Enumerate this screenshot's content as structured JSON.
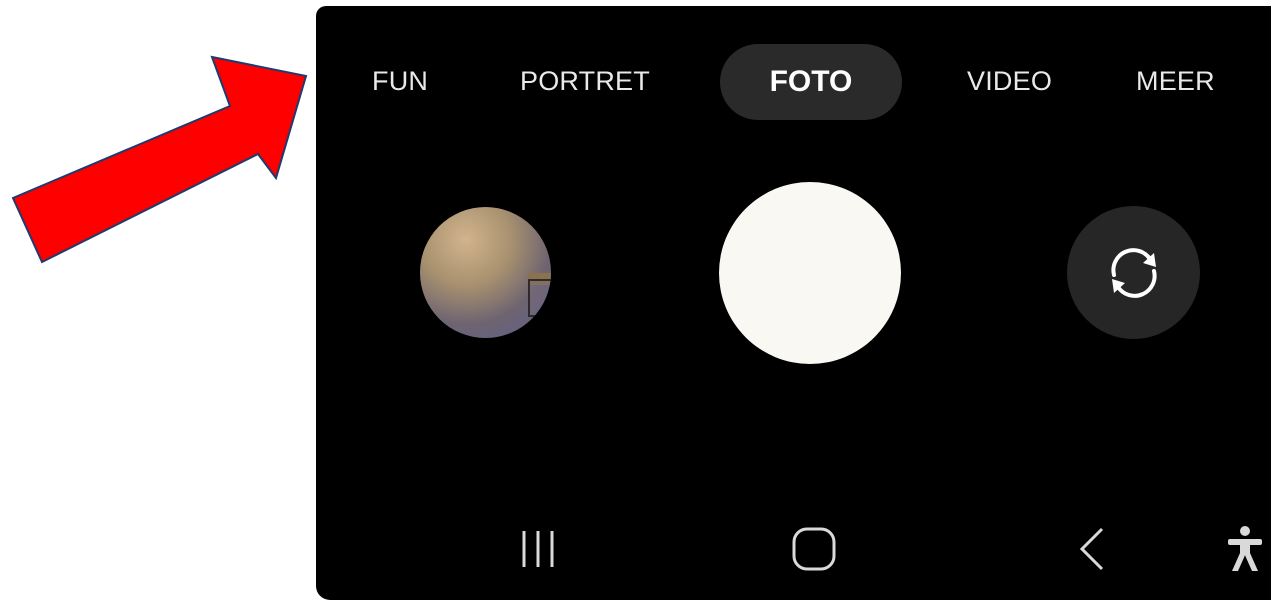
{
  "annotation": {
    "arrow_color": "#ff0000",
    "arrow_outline": "#1f3a6e",
    "arrow_icon": "arrow-right-up-icon"
  },
  "camera": {
    "background": "#000000",
    "modes": [
      {
        "label": "FUN",
        "selected": false
      },
      {
        "label": "PORTRET",
        "selected": false
      },
      {
        "label": "FOTO",
        "selected": true
      },
      {
        "label": "VIDEO",
        "selected": false
      },
      {
        "label": "MEER",
        "selected": false
      }
    ],
    "controls": {
      "gallery_icon": "gallery-thumbnail",
      "shutter_icon": "shutter-button",
      "switch_icon": "switch-camera-icon"
    }
  },
  "navigation_bar": {
    "recents_icon": "recents-icon",
    "home_icon": "home-icon",
    "back_icon": "back-icon",
    "accessibility_icon": "accessibility-icon"
  }
}
